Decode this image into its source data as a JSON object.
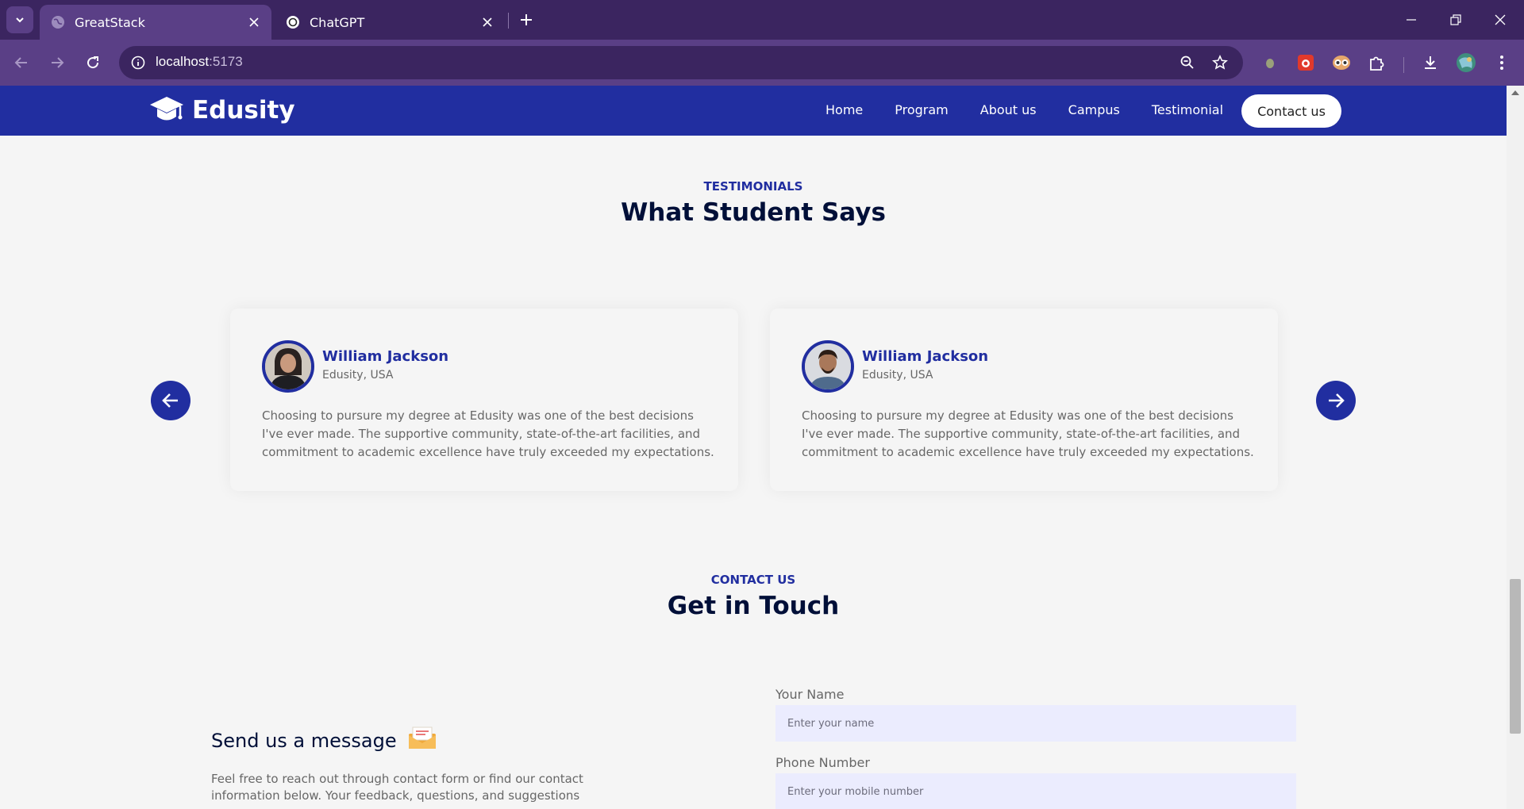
{
  "browser": {
    "tabs": [
      {
        "title": "GreatStack",
        "active": true
      },
      {
        "title": "ChatGPT",
        "active": false
      }
    ],
    "url_host": "localhost",
    "url_port": ":5173"
  },
  "site": {
    "logo": "Edusity",
    "nav": [
      "Home",
      "Program",
      "About us",
      "Campus",
      "Testimonial"
    ],
    "cta": "Contact us",
    "accent": "#212ea0"
  },
  "testimonials": {
    "subtitle": "TESTIMONIALS",
    "title": "What Student Says",
    "cards": [
      {
        "name": "William Jackson",
        "location": "Edusity, USA",
        "text": "Choosing to pursure my degree at Edusity was one of the best decisions I've ever made. The supportive community, state-of-the-art facilities, and commitment to academic excellence have truly exceeded my expectations."
      },
      {
        "name": "William Jackson",
        "location": "Edusity, USA",
        "text": "Choosing to pursure my degree at Edusity was one of the best decisions I've ever made. The supportive community, state-of-the-art facilities, and commitment to academic excellence have truly exceeded my expectations."
      }
    ]
  },
  "contact": {
    "subtitle": "CONTACT US",
    "title": "Get in Touch",
    "message_title": "Send us a message",
    "message_text": "Feel free to reach out through contact form or find our contact information below. Your feedback, questions, and suggestions",
    "fields": [
      {
        "label": "Your Name",
        "placeholder": "Enter your name"
      },
      {
        "label": "Phone Number",
        "placeholder": "Enter your mobile number"
      }
    ]
  }
}
